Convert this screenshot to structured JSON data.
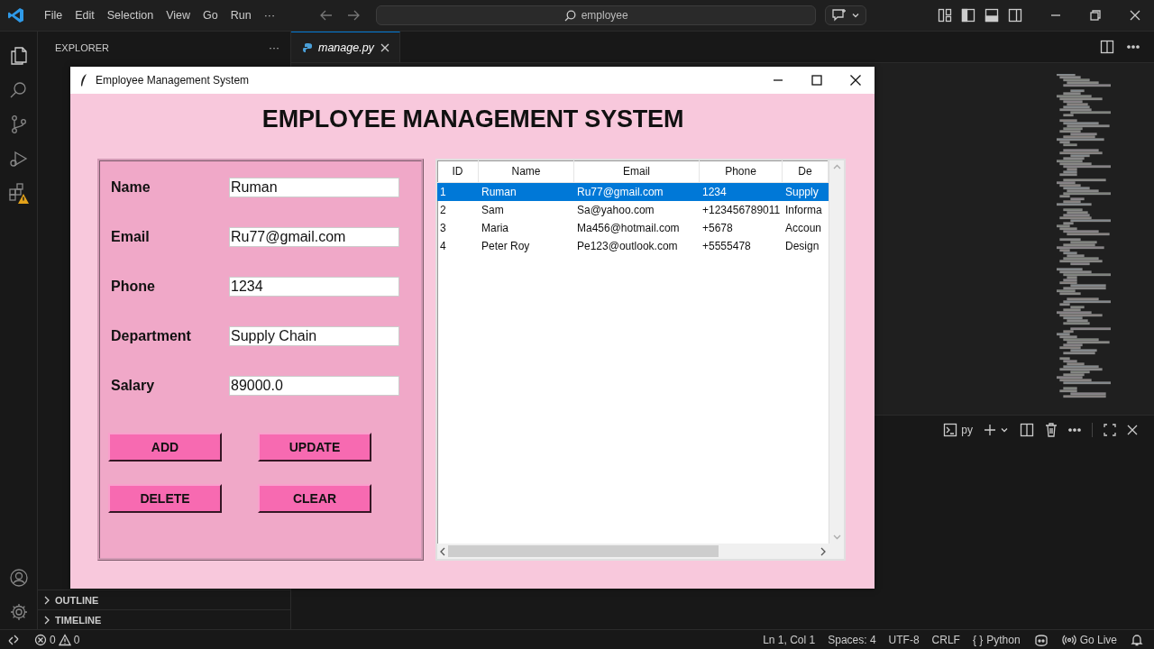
{
  "menu": [
    "File",
    "Edit",
    "Selection",
    "View",
    "Go",
    "Run",
    "···"
  ],
  "search": {
    "value": "employee"
  },
  "sidebar": {
    "title": "EXPLORER",
    "more": "···",
    "sections": [
      {
        "label": "OUTLINE",
        "expanded": false
      },
      {
        "label": "TIMELINE",
        "expanded": false
      }
    ]
  },
  "editor_tab": {
    "label": "manage.py",
    "selected": true
  },
  "terminal": {
    "label": "py"
  },
  "tk_window": {
    "title": "Employee Management System",
    "heading": "EMPLOYEE MANAGEMENT SYSTEM",
    "fields": [
      {
        "label": "Name",
        "value": "Ruman"
      },
      {
        "label": "Email",
        "value": "Ru77@gmail.com"
      },
      {
        "label": "Phone",
        "value": "1234"
      },
      {
        "label": "Department",
        "value": "Supply Chain"
      },
      {
        "label": "Salary",
        "value": "89000.0"
      }
    ],
    "buttons": [
      "ADD",
      "UPDATE",
      "DELETE",
      "CLEAR"
    ],
    "table": {
      "columns": [
        "ID",
        "Name",
        "Email",
        "Phone",
        "De"
      ],
      "rows": [
        {
          "cells": [
            "1",
            "Ruman",
            "Ru77@gmail.com",
            "1234",
            "Supply"
          ],
          "selected": true
        },
        {
          "cells": [
            "2",
            "Sam",
            "Sa@yahoo.com",
            "+123456789011",
            "Informa"
          ],
          "selected": false
        },
        {
          "cells": [
            "3",
            "Maria",
            "Ma456@hotmail.com",
            "+5678",
            "Accoun"
          ],
          "selected": false
        },
        {
          "cells": [
            "4",
            "Peter Roy",
            "Pe123@outlook.com",
            "+5555478",
            "Design"
          ],
          "selected": false
        }
      ]
    }
  },
  "status_bar": {
    "errors": "0",
    "warnings": "0",
    "items": [
      {
        "kind": "text",
        "label": "Ln 1, Col 1"
      },
      {
        "kind": "text",
        "label": "Spaces: 4"
      },
      {
        "kind": "text",
        "label": "UTF-8"
      },
      {
        "kind": "text",
        "label": "CRLF"
      },
      {
        "kind": "language",
        "icon": "{ }",
        "label": "Python"
      },
      {
        "kind": "copilot"
      },
      {
        "kind": "live",
        "label": "Go Live"
      },
      {
        "kind": "bell"
      }
    ]
  }
}
